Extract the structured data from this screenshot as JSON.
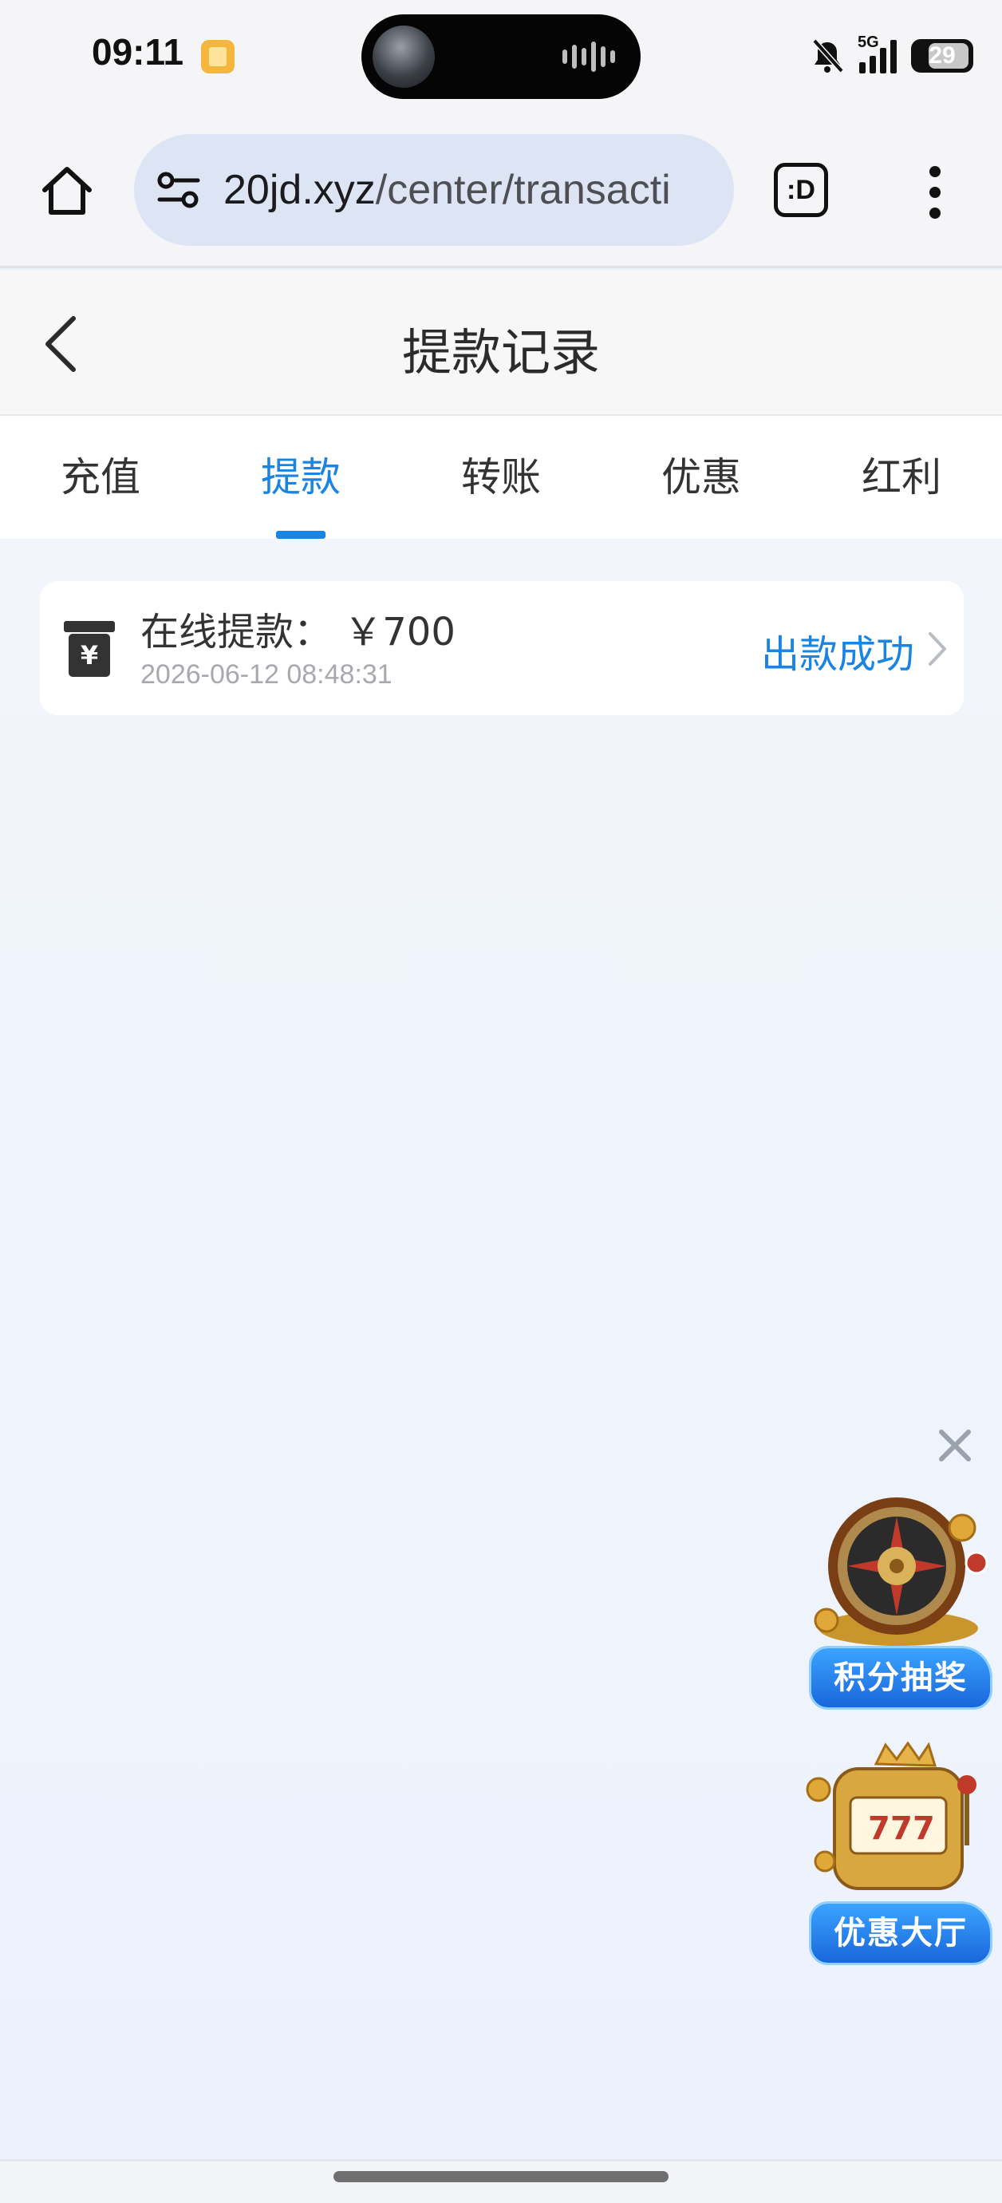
{
  "status_bar": {
    "time": "09:11",
    "network": "5G",
    "battery": "29"
  },
  "browser": {
    "url_domain": "20jd.xyz",
    "url_path": "/center/transacti",
    "tab_switcher_label": ":D"
  },
  "header": {
    "title": "提款记录"
  },
  "tabs": [
    {
      "label": "充值",
      "active": false
    },
    {
      "label": "提款",
      "active": true
    },
    {
      "label": "转账",
      "active": false
    },
    {
      "label": "优惠",
      "active": false
    },
    {
      "label": "红利",
      "active": false
    }
  ],
  "records": [
    {
      "title": "在线提款： ￥700",
      "time": "2026-06-12 08:48:31",
      "status": "出款成功"
    }
  ],
  "promos": {
    "lottery_label": "积分抽奖",
    "hall_label": "优惠大厅"
  },
  "colors": {
    "accent": "#1a84e3",
    "background": "#eef3fb"
  }
}
